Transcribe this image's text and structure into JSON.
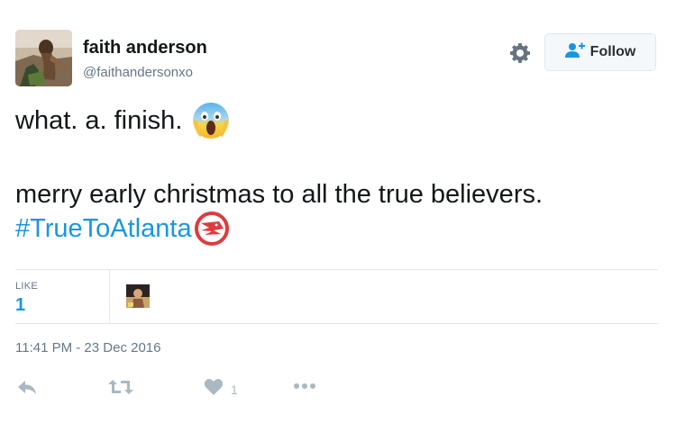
{
  "user": {
    "name": "faith anderson",
    "handle": "@faithandersonxo",
    "avatar_icon": "profile-photo"
  },
  "follow_button": {
    "label": "Follow",
    "icon": "add-user-icon"
  },
  "tweet": {
    "line1": "what. a. finish.",
    "line1_emoji": "screaming-face-emoji",
    "line2": "merry early christmas to all the true believers.",
    "hashtag": "#TrueToAtlanta",
    "hashtag_emoji": "atlanta-hawks-logo"
  },
  "stats": {
    "likes_label": "LIKE",
    "likes_count": "1"
  },
  "timestamp": "11:41 PM - 23 Dec 2016",
  "actions": {
    "like_count": "1"
  },
  "colors": {
    "link": "#1b95e0",
    "muted": "#657786",
    "icon": "#aab8c2",
    "hawks_red": "#e03a3e"
  }
}
